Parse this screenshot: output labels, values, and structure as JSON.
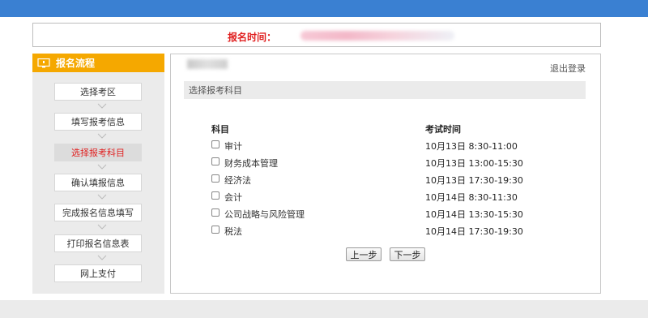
{
  "notice": {
    "label": "报名时间："
  },
  "sidebar": {
    "title": "报名流程",
    "steps": [
      {
        "label": "选择考区"
      },
      {
        "label": "填写报考信息"
      },
      {
        "label": "选择报考科目"
      },
      {
        "label": "确认填报信息"
      },
      {
        "label": "完成报名信息填写"
      },
      {
        "label": "打印报名信息表"
      },
      {
        "label": "网上支付"
      }
    ]
  },
  "main": {
    "logout": "退出登录",
    "section_title": "选择报考科目",
    "columns": {
      "subject": "科目",
      "time": "考试时间"
    },
    "rows": [
      {
        "subject": "审计",
        "time": "10月13日 8:30-11:00"
      },
      {
        "subject": "财务成本管理",
        "time": "10月13日 13:00-15:30"
      },
      {
        "subject": "经济法",
        "time": "10月13日 17:30-19:30"
      },
      {
        "subject": "会计",
        "time": "10月14日 8:30-11:30"
      },
      {
        "subject": "公司战略与风险管理",
        "time": "10月14日 13:30-15:30"
      },
      {
        "subject": "税法",
        "time": "10月14日 17:30-19:30"
      }
    ],
    "prev_button": "上一步",
    "next_button": "下一步"
  },
  "colors": {
    "topbar": "#3a80d2",
    "sidebar_header": "#f5a800",
    "active_step_text": "#e02020"
  }
}
